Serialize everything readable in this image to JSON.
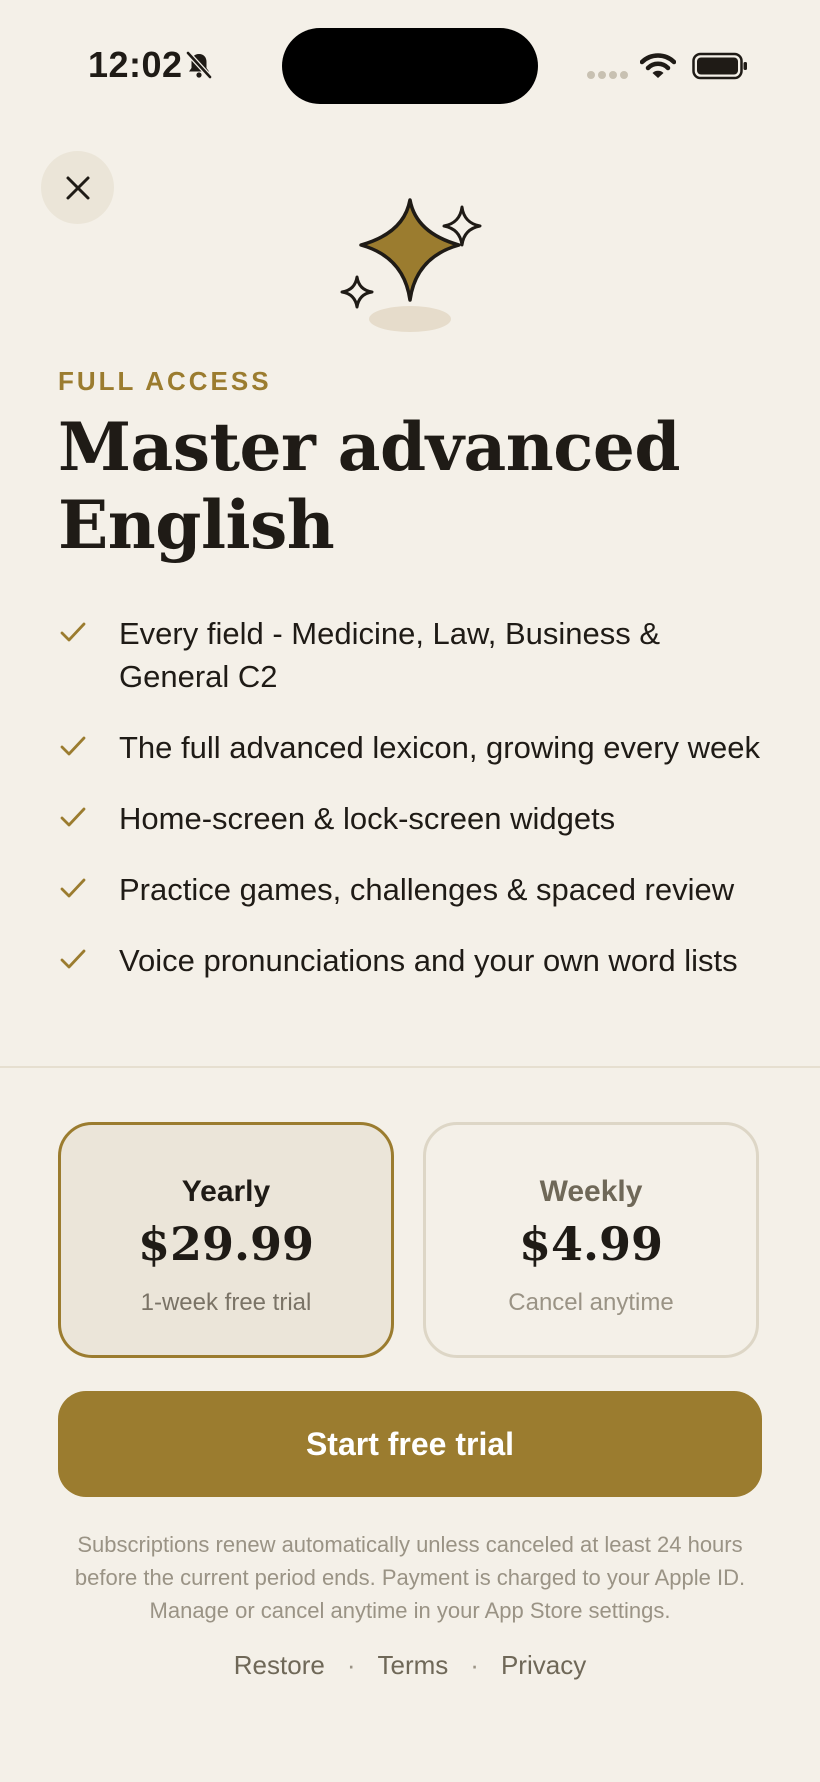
{
  "status_bar": {
    "time": "12:02"
  },
  "paywall": {
    "eyebrow": "FULL ACCESS",
    "headline": "Master advanced English",
    "features": [
      "Every field - Medicine, Law, Business & General C2",
      "The full advanced lexicon, growing every week",
      "Home-screen & lock-screen widgets",
      "Practice games, challenges & spaced review",
      "Voice pronunciations and your own word lists"
    ],
    "plans": [
      {
        "name": "Yearly",
        "price": "$29.99",
        "note": "1-week free trial",
        "selected": true
      },
      {
        "name": "Weekly",
        "price": "$4.99",
        "note": "Cancel anytime",
        "selected": false
      }
    ],
    "cta_label": "Start free trial",
    "legal_text": "Subscriptions renew automatically unless canceled at least 24 hours before the current period ends. Payment is charged to your Apple ID. Manage or cancel anytime in your App Store settings.",
    "links": {
      "restore": "Restore",
      "separator": "·",
      "terms": "Terms",
      "privacy": "Privacy"
    }
  },
  "colors": {
    "accent": "#9b7c2f",
    "background": "#f4f0e8",
    "text": "#1f1b16"
  },
  "icons": {
    "close": "close-icon",
    "hero": "sparkles-icon",
    "check": "checkmark-icon",
    "status": [
      "bell-slash-icon",
      "cellular-signal-icon",
      "wifi-icon",
      "battery-icon"
    ]
  }
}
